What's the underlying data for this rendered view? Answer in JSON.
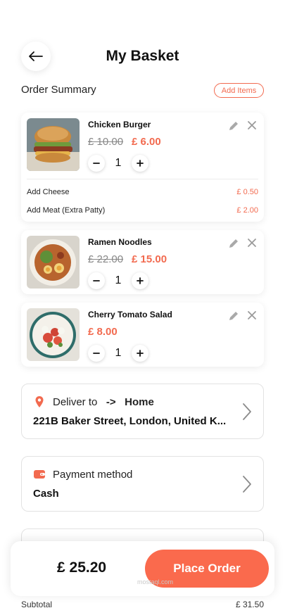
{
  "header": {
    "title": "My Basket"
  },
  "summary": {
    "label": "Order Summary",
    "add_items": "Add Items"
  },
  "items": [
    {
      "name": "Chicken Burger",
      "old_price": "£ 10.00",
      "price": "£ 6.00",
      "qty": "1",
      "addons": [
        {
          "name": "Add Cheese",
          "price": "£ 0.50"
        },
        {
          "name": "Add Meat (Extra Patty)",
          "price": "£ 2.00"
        }
      ]
    },
    {
      "name": "Ramen Noodles",
      "old_price": "£ 22.00",
      "price": "£ 15.00",
      "qty": "1",
      "addons": []
    },
    {
      "name": "Cherry Tomato Salad",
      "old_price": "",
      "price": "£ 8.00",
      "qty": "1",
      "addons": []
    }
  ],
  "delivery": {
    "label": "Deliver to",
    "arrow": "->",
    "place": "Home",
    "address": "221B Baker Street, London, United K..."
  },
  "payment": {
    "label": "Payment method",
    "value": "Cash"
  },
  "checkout": {
    "total": "£ 25.20",
    "button": "Place Order"
  },
  "watermark": {
    "text": "mostaql.com"
  },
  "subtotal_peek": {
    "label": "Subtotal",
    "value": "£ 31.50"
  },
  "colors": {
    "accent": "#fa6a4d",
    "price": "#f26a4f"
  },
  "icons": {
    "back": "arrow-left-icon",
    "edit": "pencil-icon",
    "remove": "close-icon",
    "location": "map-pin-icon",
    "payment": "wallet-icon",
    "chevron": "chevron-right-icon"
  }
}
